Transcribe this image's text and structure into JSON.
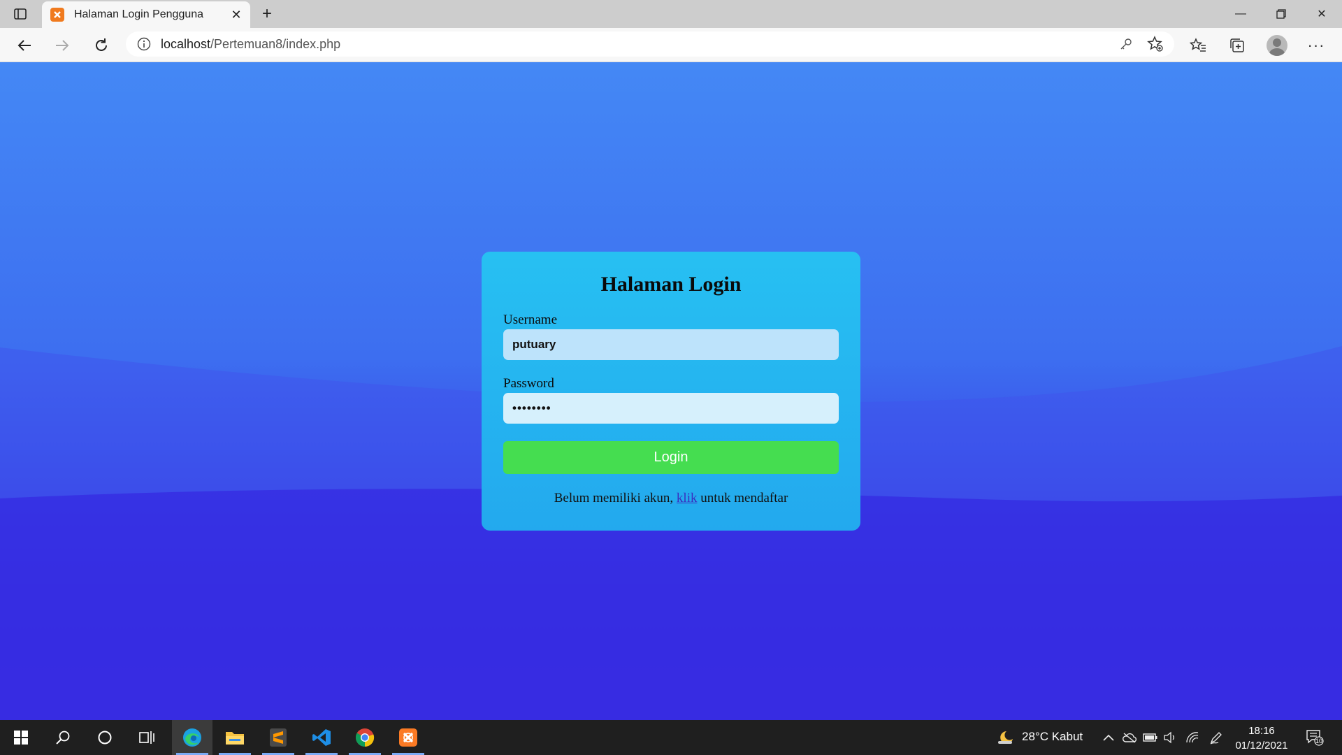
{
  "browser": {
    "tab": {
      "title": "Halaman Login Pengguna"
    },
    "address": {
      "host": "localhost",
      "path": "/Pertemuan8/index.php"
    }
  },
  "page": {
    "title": "Halaman Login",
    "username_label": "Username",
    "username_value": "putuary",
    "password_label": "Password",
    "password_value": "••••••••",
    "login_button": "Login",
    "footer_before": "Belum memiliki akun, ",
    "footer_link": "klik",
    "footer_after": " untuk mendaftar",
    "colors": {
      "card": "#27c0f2",
      "button": "#45dd50",
      "bg_top": "#4488f5",
      "bg_bottom": "#3426e0"
    }
  },
  "taskbar": {
    "weather": "28°C  Kabut",
    "time": "18:16",
    "date": "01/12/2021",
    "notification_count": "10",
    "apps": [
      "windows-start-icon",
      "search-icon",
      "cortana-icon",
      "task-view-icon",
      "edge-icon",
      "file-explorer-icon",
      "sublime-text-icon",
      "vscode-icon",
      "chrome-icon",
      "xampp-icon"
    ]
  }
}
